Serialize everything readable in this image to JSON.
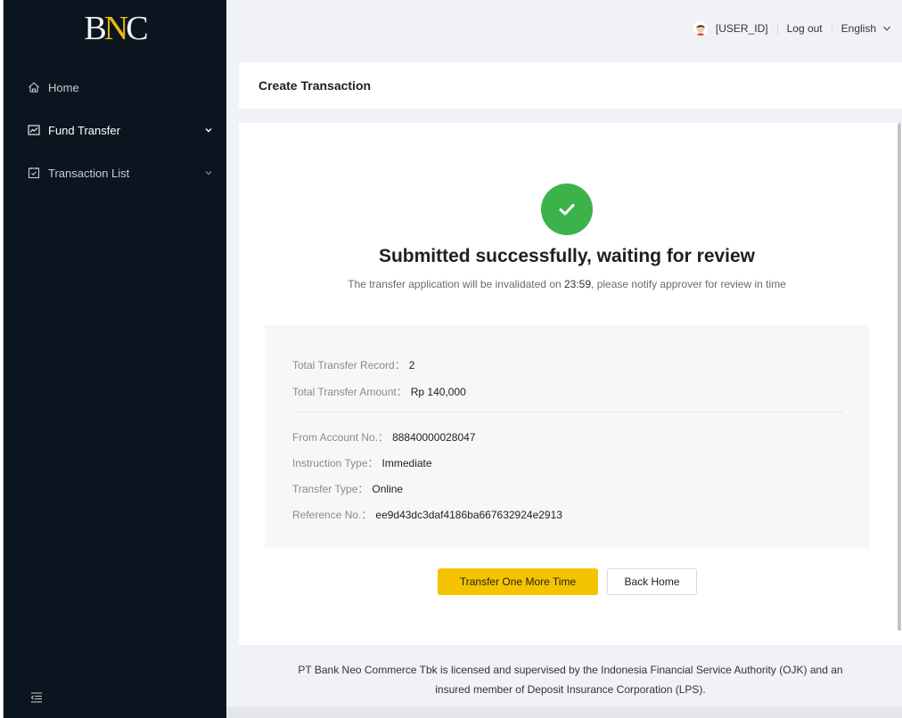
{
  "brand": {
    "logo_text_left": "B",
    "logo_text_mid": "N",
    "logo_text_right": "C"
  },
  "sidebar": {
    "items": [
      {
        "label": "Home",
        "icon": "home-icon"
      },
      {
        "label": "Fund Transfer",
        "icon": "chart-icon"
      },
      {
        "label": "Transaction List",
        "icon": "checkbox-icon"
      }
    ],
    "collapse_icon": "menu-fold-icon"
  },
  "header": {
    "user_id": "[USER_ID]",
    "logout": "Log out",
    "language": "English"
  },
  "page": {
    "title": "Create Transaction"
  },
  "result": {
    "title": "Submitted successfully, waiting for review",
    "subtitle_prefix": "The transfer application will be invalidated on ",
    "subtitle_time": "23:59",
    "subtitle_suffix": ", please notify approver for review in time"
  },
  "details": {
    "total_record_label": "Total Transfer Record",
    "total_record_value": "2",
    "total_amount_label": "Total Transfer Amount",
    "total_amount_value": "Rp 140,000",
    "from_account_label": "From Account No.",
    "from_account_value": "88840000028047",
    "instruction_type_label": "Instruction Type",
    "instruction_type_value": "Immediate",
    "transfer_type_label": "Transfer Type",
    "transfer_type_value": "Online",
    "reference_label": "Reference No.",
    "reference_value": "ee9d43dc3daf4186ba667632924e2913",
    "colon": "："
  },
  "actions": {
    "primary": "Transfer One More Time",
    "secondary": "Back Home"
  },
  "footer": {
    "line1": "PT Bank Neo Commerce Tbk is licensed and supervised by the Indonesia Financial Service Authority (OJK) and an",
    "line2": "insured member of Deposit Insurance Corporation (LPS)."
  },
  "colors": {
    "sidebar_bg": "#0a1520",
    "accent": "#f5c400",
    "success": "#3cb34a",
    "logo_accent": "#e8b814"
  }
}
